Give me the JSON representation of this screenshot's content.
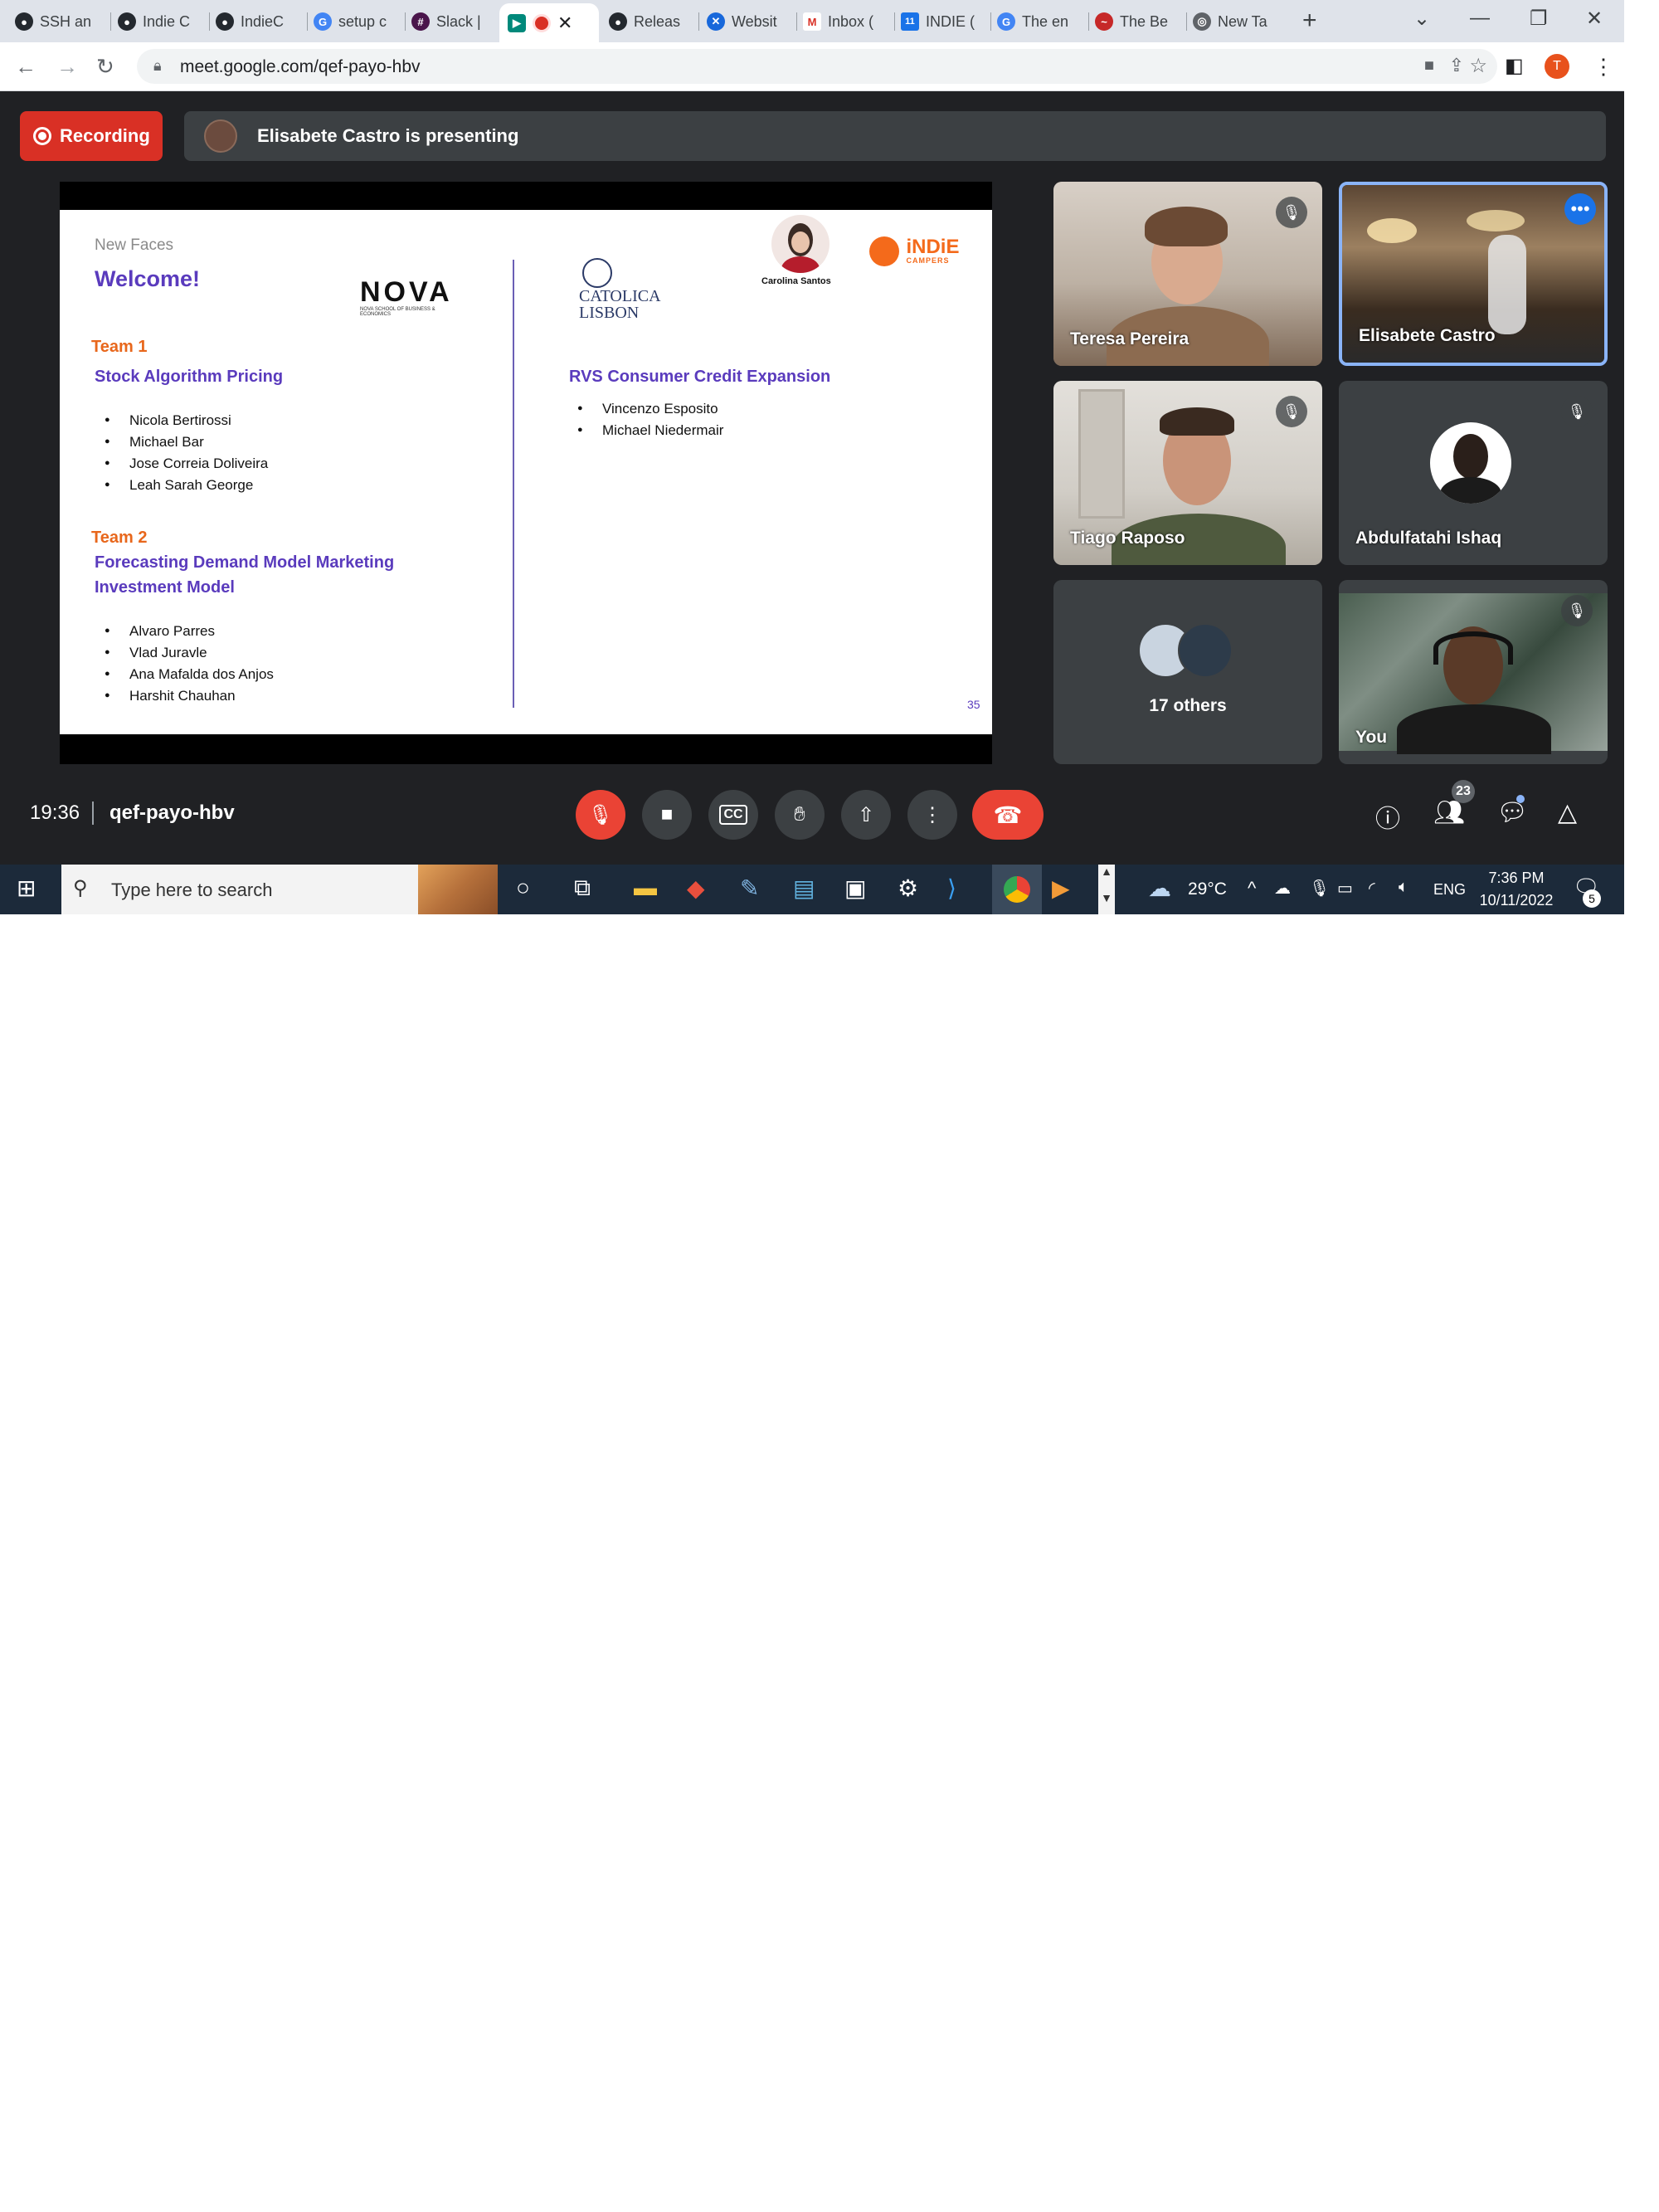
{
  "tabs": [
    {
      "label": "SSH an",
      "icon": "github-icon"
    },
    {
      "label": "Indie C",
      "icon": "github-icon"
    },
    {
      "label": "IndieC",
      "icon": "github-icon"
    },
    {
      "label": "setup c",
      "icon": "google-icon"
    },
    {
      "label": "Slack |",
      "icon": "slack-icon"
    },
    {
      "label": "",
      "icon": "meet-icon",
      "active": true
    },
    {
      "label": "Releas",
      "icon": "github-icon"
    },
    {
      "label": "Websit",
      "icon": "confluence-icon"
    },
    {
      "label": "Inbox (",
      "icon": "gmail-icon"
    },
    {
      "label": "INDIE (",
      "icon": "calendar-icon"
    },
    {
      "label": "The en",
      "icon": "google-icon"
    },
    {
      "label": "The Be",
      "icon": "red-logo-icon"
    },
    {
      "label": "New Ta",
      "icon": "chrome-icon"
    }
  ],
  "browser": {
    "url": "meet.google.com/qef-payo-hbv",
    "profile_initial": "T"
  },
  "meet": {
    "recording_label": "Recording",
    "presenting_text": "Elisabete Castro is presenting",
    "time": "19:36",
    "meeting_code": "qef-payo-hbv",
    "participants_count": "23"
  },
  "slide": {
    "kicker": "New Faces",
    "title": "Welcome!",
    "logo_nova": "NOVA",
    "logo_nova_sub": "NOVA SCHOOL OF BUSINESS & ECONOMICS",
    "logo_catolica_1": "CATOLICA",
    "logo_catolica_2": "LISBON",
    "person_name": "Carolina Santos",
    "logo_indie": "iNDiE",
    "logo_indie_sub": "CAMPERS",
    "team1_label": "Team 1",
    "team1_project": "Stock Algorithm Pricing",
    "team1_members": [
      "Nicola Bertirossi",
      "Michael Bar",
      "Jose Correia Doliveira",
      "Leah Sarah George"
    ],
    "team2_label": "Team 2",
    "team2_project_line1": "Forecasting Demand Model Marketing",
    "team2_project_line2": "Investment Model",
    "team2_members": [
      "Alvaro Parres",
      "Vlad Juravle",
      "Ana Mafalda dos Anjos",
      "Harshit Chauhan"
    ],
    "team3_project": "RVS Consumer Credit Expansion",
    "team3_members": [
      "Vincenzo Esposito",
      "Michael Niedermair"
    ],
    "page_number": "35"
  },
  "tiles": [
    {
      "name": "Teresa Pereira",
      "muted": true
    },
    {
      "name": "Elisabete Castro",
      "muted": false,
      "active": true
    },
    {
      "name": "Tiago Raposo",
      "muted": true
    },
    {
      "name": "Abdulfatahi Ishaq",
      "muted": true
    },
    {
      "name": "17 others",
      "muted": false
    },
    {
      "name": "You",
      "muted": true
    }
  ],
  "taskbar": {
    "search_placeholder": "Type here to search",
    "weather": "29°C",
    "language": "ENG",
    "clock_time": "7:36 PM",
    "clock_date": "10/11/2022",
    "notifications": "5"
  },
  "colors": {
    "meet_bg": "#202124",
    "recording_red": "#d93025",
    "slide_purple": "#5a3bbd",
    "slide_orange": "#e8671c",
    "active_tile_border": "#8ab4f8"
  }
}
